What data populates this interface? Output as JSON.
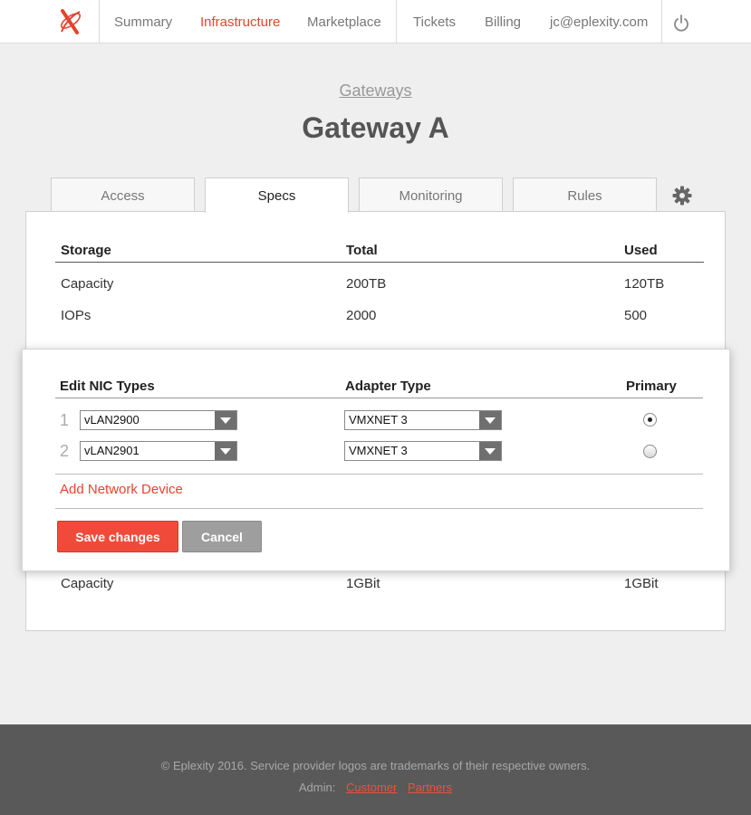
{
  "nav": {
    "items": [
      {
        "label": "Summary",
        "active": false
      },
      {
        "label": "Infrastructure",
        "active": true
      },
      {
        "label": "Marketplace",
        "active": false
      },
      {
        "label": "Tickets",
        "active": false
      },
      {
        "label": "Billing",
        "active": false
      }
    ],
    "user_email": "jc@eplexity.com",
    "logo_icon": "eplexity-x-logo",
    "power_icon": "power-icon",
    "accent_color": "#e4442f"
  },
  "header": {
    "breadcrumb": "Gateways",
    "title": "Gateway A"
  },
  "tabs": [
    {
      "label": "Access",
      "active": false
    },
    {
      "label": "Specs",
      "active": true
    },
    {
      "label": "Monitoring",
      "active": false
    },
    {
      "label": "Rules",
      "active": false
    }
  ],
  "settings_icon": "gear-icon",
  "storage": {
    "columns": [
      "Storage",
      "Total",
      "Used"
    ],
    "rows": [
      [
        "Capacity",
        "200TB",
        "120TB"
      ],
      [
        "IOPs",
        "2000",
        "500"
      ]
    ]
  },
  "network_partial": {
    "row": [
      "Capacity",
      "1GBit",
      "1GBit"
    ]
  },
  "modal": {
    "columns": [
      "Edit NIC Types",
      "Adapter Type",
      "Primary"
    ],
    "rows": [
      {
        "index": "1",
        "nic": "vLAN2900",
        "adapter": "VMXNET 3",
        "primary": true
      },
      {
        "index": "2",
        "nic": "vLAN2901",
        "adapter": "VMXNET 3",
        "primary": false
      }
    ],
    "add_label": "Add Network Device",
    "save_label": "Save changes",
    "cancel_label": "Cancel"
  },
  "footer": {
    "copyright": "© Eplexity 2016. Service provider logos are trademarks of their respective owners.",
    "admin_label": "Admin:",
    "links": [
      "Customer",
      "Partners"
    ]
  }
}
